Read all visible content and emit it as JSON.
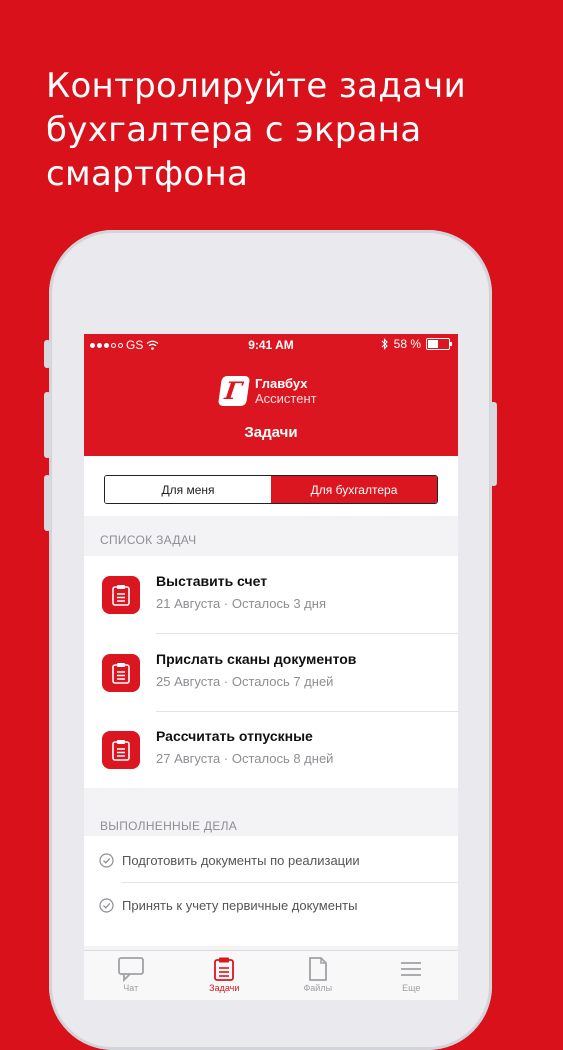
{
  "promo": {
    "line1": "Контролируйте задачи",
    "line2": "бухгалтера с экрана",
    "line3": "смартфона"
  },
  "status_bar": {
    "carrier": "GS",
    "time": "9:41 AM",
    "battery": "58 %",
    "battery_level": 0.58
  },
  "app": {
    "brand_name": "Главбух",
    "brand_sub": "Ассистент",
    "screen_title": "Задачи"
  },
  "segments": [
    {
      "label": "Для меня",
      "selected": true
    },
    {
      "label": "Для бухгалтера",
      "selected": false
    }
  ],
  "task_section": {
    "heading": "СПИСОК ЗАДАЧ",
    "tasks": [
      {
        "title": "Выставить счет",
        "subtitle": "21 Августа · Осталось 3 дня"
      },
      {
        "title": "Прислать сканы документов",
        "subtitle": "25 Августа · Осталось 7 дней"
      },
      {
        "title": "Рассчитать отпускные",
        "subtitle": "27 Августа · Осталось 8 дней"
      }
    ]
  },
  "done_section": {
    "heading": "ВЫПОЛНЕННЫЕ ДЕЛА",
    "items": [
      {
        "text": "Подготовить документы по реализации"
      },
      {
        "text": "Принять к учету первичные документы"
      }
    ]
  },
  "tabbar": {
    "tabs": [
      {
        "label": "Чат",
        "icon": "chat-icon",
        "active": false
      },
      {
        "label": "Задачи",
        "icon": "tasks-icon",
        "active": true
      },
      {
        "label": "Файлы",
        "icon": "file-icon",
        "active": false
      },
      {
        "label": "Еще",
        "icon": "menu-icon",
        "active": false
      }
    ]
  },
  "colors": {
    "brand_red": "#dc1620",
    "background_red": "#d9111a",
    "inactive_gray": "#a0a0a6"
  }
}
